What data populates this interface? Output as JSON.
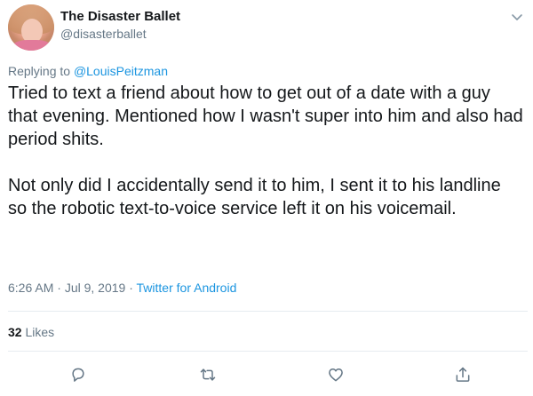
{
  "tweet": {
    "display_name": "The Disaster Ballet",
    "handle": "@disasterballet",
    "replying_prefix": "Replying to ",
    "replying_to": "@LouisPeitzman",
    "paragraphs": [
      "Tried to text a friend about how to get out of a date with a guy that evening. Mentioned how I wasn't super into him and also had period shits.",
      "Not only did I accidentally send it to him, I sent it to his landline so the robotic text-to-voice service left it on his voicemail."
    ],
    "time": "6:26 AM",
    "separator": " · ",
    "date": "Jul 9, 2019",
    "source": "Twitter for Android",
    "likes_count": "32",
    "likes_label": " Likes"
  },
  "icons": {
    "menu": "chevron-down-icon",
    "reply": "reply-icon",
    "retweet": "retweet-icon",
    "like": "heart-icon",
    "share": "share-icon"
  },
  "colors": {
    "text": "#14171a",
    "secondary": "#657786",
    "link": "#1b95e0",
    "divider": "#e6ecf0"
  }
}
